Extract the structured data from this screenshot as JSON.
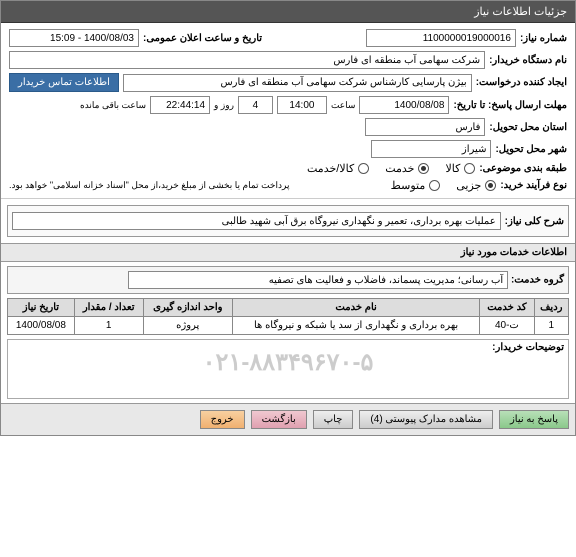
{
  "header": {
    "title": "جزئیات اطلاعات نیاز"
  },
  "need": {
    "number_label": "شماره نیاز:",
    "number": "1100000019000016",
    "public_date_label": "تاریخ و ساعت اعلان عمومی:",
    "public_date": "1400/08/03 - 15:09",
    "buyer_label": "نام دستگاه خریدار:",
    "buyer": "شرکت سهامی آب منطقه ای فارس",
    "requester_label": "ایجاد کننده درخواست:",
    "requester": "بیژن پارسایی کارشناس شرکت سهامی آب منطقه ای فارس",
    "contact_tab": "اطلاعات تماس خریدار",
    "deadline_label": "مهلت ارسال پاسخ: تا تاریخ:",
    "deadline_date": "1400/08/08",
    "time_label": "ساعت",
    "deadline_time": "14:00",
    "day_label": "روز و",
    "days": "4",
    "remaining_time": "22:44:14",
    "remaining_label": "ساعت باقی مانده",
    "province_label": "استان محل تحویل:",
    "province": "فارس",
    "city_label": "شهر محل تحویل:",
    "city": "شیراز",
    "subject_type_label": "طبقه بندی موضوعی:",
    "radio_kala": "کالا",
    "radio_khedmat": "خدمت",
    "radio_kala_khedmat": "کالا/خدمت",
    "buy_type_label": "نوع فرآیند خرید:",
    "radio_jozi": "جزیی",
    "radio_motevaset": "متوسط",
    "payment_note": "پرداخت تمام یا بخشی از مبلغ خرید،از محل \"اسناد خزانه اسلامی\" خواهد بود."
  },
  "desc": {
    "title_label": "شرح کلی نیاز:",
    "title": "عملیات بهره برداری، تعمیر و نگهداری نیروگاه برق آبی شهید طالبی",
    "sub_header": "اطلاعات خدمات مورد نیاز",
    "group_label": "گروه خدمت:",
    "group": "آب رسانی؛ مدیریت پسماند، فاضلاب و فعالیت های تصفیه"
  },
  "table": {
    "headers": [
      "ردیف",
      "کد خدمت",
      "نام خدمت",
      "واحد اندازه گیری",
      "تعداد / مقدار",
      "تاریخ نیاز"
    ],
    "rows": [
      {
        "idx": "1",
        "code": "ت-40",
        "name": "بهره برداری و نگهداری از سد یا شبکه و نیروگاه ها",
        "unit": "پروژه",
        "qty": "1",
        "date": "1400/08/08"
      }
    ]
  },
  "tel": {
    "label": "توضیحات خریدار:",
    "number": "۰۲۱-۸۸۳۴۹۶۷۰-۵"
  },
  "buttons": {
    "respond": "پاسخ به نیاز",
    "attach": "مشاهده مدارک پیوستی (4)",
    "print": "چاپ",
    "back": "بازگشت",
    "exit": "خروج"
  }
}
